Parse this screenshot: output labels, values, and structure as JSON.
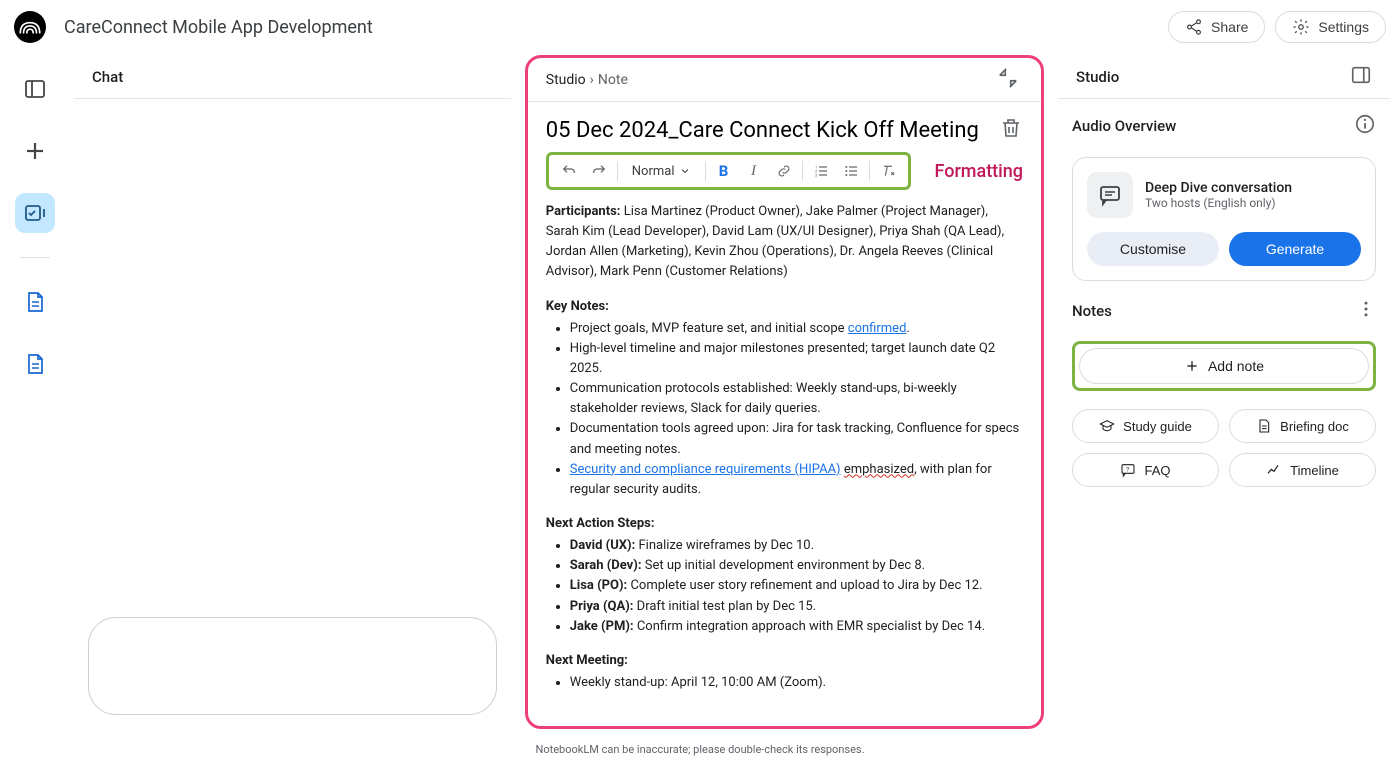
{
  "header": {
    "app_title": "CareConnect Mobile App Development",
    "share": "Share",
    "settings": "Settings"
  },
  "chat": {
    "title": "Chat"
  },
  "editor": {
    "breadcrumb_studio": "Studio",
    "breadcrumb_note": "Note",
    "note_title": "05 Dec 2024_Care Connect Kick Off Meeting",
    "formatting_label": "Formatting",
    "style_select": "Normal",
    "content": {
      "participants_label": "Participants:",
      "participants_text": " Lisa Martinez (Product Owner), Jake Palmer (Project Manager), Sarah Kim (Lead Developer), David Lam (UX/UI Designer), Priya Shah (QA Lead), Jordan Allen (Marketing), Kevin Zhou (Operations), Dr. Angela Reeves (Clinical Advisor), Mark Penn (Customer Relations)",
      "key_notes_heading": "Key Notes:",
      "key_notes": {
        "item1_pre": "Project goals, MVP feature set, and initial scope ",
        "item1_link": "confirmed",
        "item1_post": ".",
        "item2": "High-level timeline and major milestones presented; target launch date Q2 2025.",
        "item3": "Communication protocols established: Weekly stand-ups, bi-weekly stakeholder reviews, Slack for daily queries.",
        "item4": "Documentation tools agreed upon: Jira for task tracking, Confluence for specs and meeting notes.",
        "item5_link": "Security and compliance requirements (HIPAA)",
        "item5_post_pre": " ",
        "item5_post_word": "emphasized",
        "item5_post_tail": ", with plan for regular security audits."
      },
      "next_actions_heading": "Next Action Steps:",
      "next_actions": {
        "a1_b": "David (UX):",
        "a1_t": " Finalize wireframes by Dec 10.",
        "a2_b": "Sarah (Dev):",
        "a2_t": " Set up initial development environment by Dec 8.",
        "a3_b": "Lisa (PO):",
        "a3_t": " Complete user story refinement and upload to Jira by Dec 12.",
        "a4_b": "Priya (QA):",
        "a4_t": " Draft initial test plan by Dec 15.",
        "a5_b": "Jake (PM):",
        "a5_t": " Confirm integration approach with EMR specialist by Dec 14."
      },
      "next_meeting_heading": "Next Meeting:",
      "next_meeting_item": "Weekly stand-up: April 12, 10:00 AM (Zoom)."
    }
  },
  "studio": {
    "title": "Studio",
    "audio_overview": "Audio Overview",
    "deep_dive": "Deep Dive conversation",
    "deep_dive_sub": "Two hosts (English only)",
    "customise": "Customise",
    "generate": "Generate",
    "notes": "Notes",
    "add_note": "Add note",
    "study_guide": "Study guide",
    "briefing_doc": "Briefing doc",
    "faq": "FAQ",
    "timeline": "Timeline"
  },
  "disclaimer": "NotebookLM can be inaccurate; please double-check its responses."
}
